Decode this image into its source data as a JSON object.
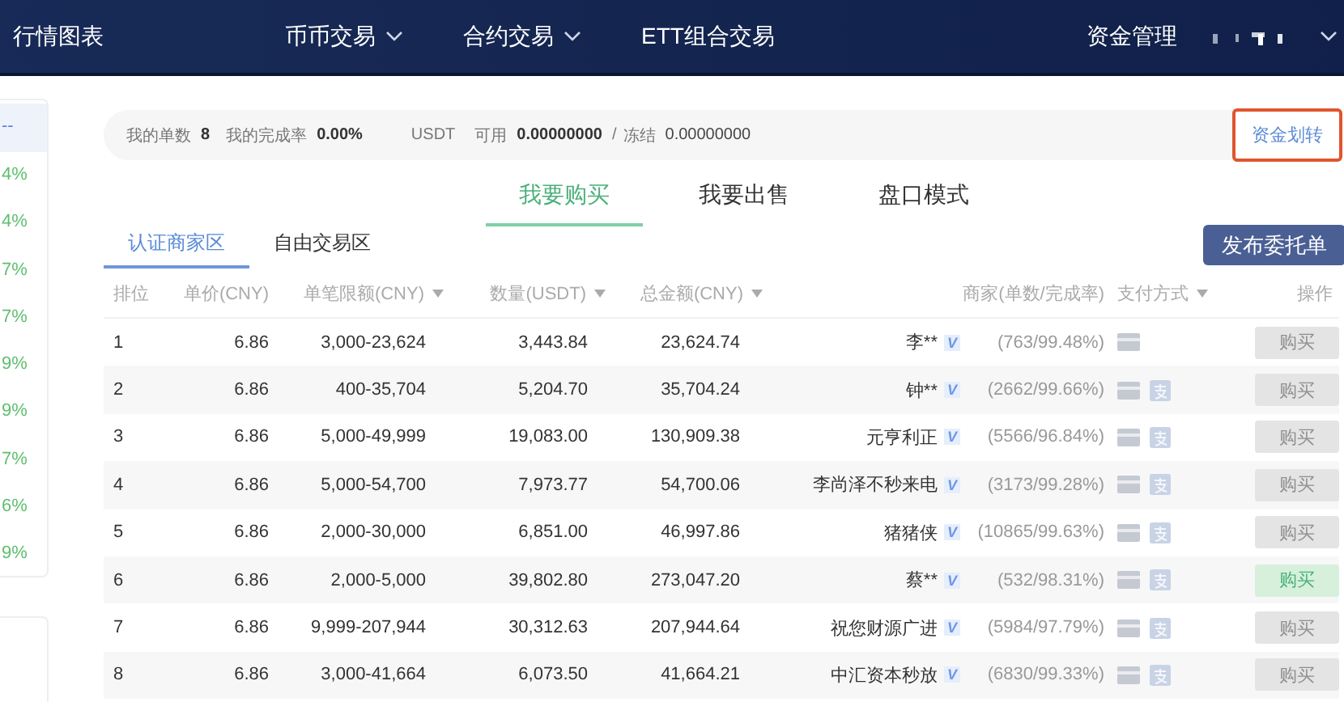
{
  "nav": {
    "items": [
      {
        "label": "行情图表",
        "dropdown": false
      },
      {
        "label": "币币交易",
        "dropdown": true
      },
      {
        "label": "合约交易",
        "dropdown": true
      },
      {
        "label": "ETT组合交易",
        "dropdown": false
      }
    ],
    "right": "资金管理"
  },
  "sidebar": {
    "values": [
      "--",
      "4%",
      "4%",
      "7%",
      "7%",
      "9%",
      "9%",
      "7%",
      "6%",
      "9%"
    ]
  },
  "info_bar": {
    "orders_label": "我的单数",
    "orders": "8",
    "rate_label": "我的完成率",
    "rate": "0.00%",
    "currency": "USDT",
    "available_label": "可用",
    "available": "0.00000000",
    "separator": "/",
    "frozen_label": "冻结",
    "frozen": "0.00000000",
    "transfer_link": "资金划转"
  },
  "mode_tabs": [
    {
      "label": "我要购买",
      "selected": true
    },
    {
      "label": "我要出售",
      "selected": false
    },
    {
      "label": "盘口模式",
      "selected": false
    }
  ],
  "zone_tabs": [
    {
      "label": "认证商家区",
      "selected": true
    },
    {
      "label": "自由交易区",
      "selected": false
    }
  ],
  "publish_button": "发布委托单",
  "table": {
    "columns": [
      {
        "label": "排位",
        "sortable": false
      },
      {
        "label": "单价(CNY)",
        "sortable": false
      },
      {
        "label": "单笔限额(CNY)",
        "sortable": true
      },
      {
        "label": "数量(USDT)",
        "sortable": true
      },
      {
        "label": "总金额(CNY)",
        "sortable": true
      },
      {
        "label": "商家(单数/完成率)",
        "sortable": false
      },
      {
        "label": "支付方式",
        "sortable": true
      },
      {
        "label": "操作",
        "sortable": false
      }
    ],
    "rows": [
      {
        "rank": "1",
        "price": "6.86",
        "limit": "3,000-23,624",
        "quantity": "3,443.84",
        "total": "23,624.74",
        "merchant": "李**",
        "badge": "V",
        "stats": "(763/99.48%)",
        "card": true,
        "alipay": false,
        "action": "购买",
        "enabled": false
      },
      {
        "rank": "2",
        "price": "6.86",
        "limit": "400-35,704",
        "quantity": "5,204.70",
        "total": "35,704.24",
        "merchant": "钟**",
        "badge": "V",
        "stats": "(2662/99.66%)",
        "card": true,
        "alipay": true,
        "action": "购买",
        "enabled": false
      },
      {
        "rank": "3",
        "price": "6.86",
        "limit": "5,000-49,999",
        "quantity": "19,083.00",
        "total": "130,909.38",
        "merchant": "元亨利正",
        "badge": "V",
        "stats": "(5566/96.84%)",
        "card": true,
        "alipay": true,
        "action": "购买",
        "enabled": false
      },
      {
        "rank": "4",
        "price": "6.86",
        "limit": "5,000-54,700",
        "quantity": "7,973.77",
        "total": "54,700.06",
        "merchant": "李尚泽不秒来电",
        "badge": "V",
        "stats": "(3173/99.28%)",
        "card": true,
        "alipay": true,
        "action": "购买",
        "enabled": false
      },
      {
        "rank": "5",
        "price": "6.86",
        "limit": "2,000-30,000",
        "quantity": "6,851.00",
        "total": "46,997.86",
        "merchant": "猪猪侠",
        "badge": "V",
        "stats": "(10865/99.63%)",
        "card": true,
        "alipay": true,
        "action": "购买",
        "enabled": false
      },
      {
        "rank": "6",
        "price": "6.86",
        "limit": "2,000-5,000",
        "quantity": "39,802.80",
        "total": "273,047.20",
        "merchant": "蔡**",
        "badge": "V",
        "stats": "(532/98.31%)",
        "card": true,
        "alipay": true,
        "action": "购买",
        "enabled": true
      },
      {
        "rank": "7",
        "price": "6.86",
        "limit": "9,999-207,944",
        "quantity": "30,312.63",
        "total": "207,944.64",
        "merchant": "祝您财源广进",
        "badge": "V",
        "stats": "(5984/97.79%)",
        "card": true,
        "alipay": true,
        "action": "购买",
        "enabled": false
      },
      {
        "rank": "8",
        "price": "6.86",
        "limit": "3,000-41,664",
        "quantity": "6,073.50",
        "total": "41,664.21",
        "merchant": "中汇资本秒放",
        "badge": "V",
        "stats": "(6830/99.33%)",
        "card": true,
        "alipay": true,
        "action": "购买",
        "enabled": false
      }
    ]
  }
}
